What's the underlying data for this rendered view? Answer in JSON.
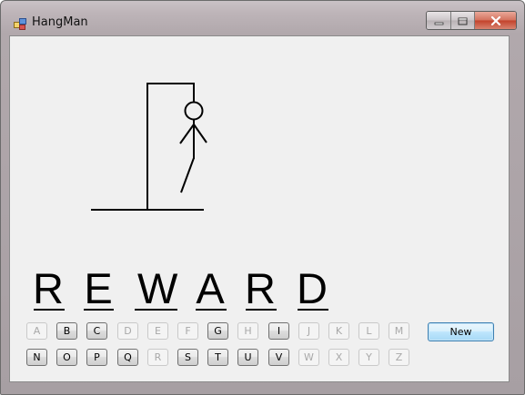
{
  "window": {
    "title": "HangMan",
    "icon": "app-window-icon",
    "controls": {
      "minimize": "minimize-icon",
      "maximize": "maximize-icon",
      "close": "close-icon"
    }
  },
  "hangman": {
    "drawing": "gallows-with-figure",
    "parts_shown": [
      "base",
      "post",
      "beam",
      "rope",
      "head",
      "body",
      "left-arm",
      "right-arm",
      "left-leg"
    ]
  },
  "word": {
    "letters": [
      "R",
      "E",
      "W",
      "A",
      "R",
      "D"
    ]
  },
  "keyboard": {
    "row1": [
      {
        "label": "A",
        "enabled": false
      },
      {
        "label": "B",
        "enabled": true
      },
      {
        "label": "C",
        "enabled": true
      },
      {
        "label": "D",
        "enabled": false
      },
      {
        "label": "E",
        "enabled": false
      },
      {
        "label": "F",
        "enabled": false
      },
      {
        "label": "G",
        "enabled": true
      },
      {
        "label": "H",
        "enabled": false
      },
      {
        "label": "I",
        "enabled": true
      },
      {
        "label": "J",
        "enabled": false
      },
      {
        "label": "K",
        "enabled": false
      },
      {
        "label": "L",
        "enabled": false
      },
      {
        "label": "M",
        "enabled": false
      }
    ],
    "row2": [
      {
        "label": "N",
        "enabled": true
      },
      {
        "label": "O",
        "enabled": true
      },
      {
        "label": "P",
        "enabled": true
      },
      {
        "label": "Q",
        "enabled": true
      },
      {
        "label": "R",
        "enabled": false
      },
      {
        "label": "S",
        "enabled": true
      },
      {
        "label": "T",
        "enabled": true
      },
      {
        "label": "U",
        "enabled": true
      },
      {
        "label": "V",
        "enabled": true
      },
      {
        "label": "W",
        "enabled": false
      },
      {
        "label": "X",
        "enabled": false
      },
      {
        "label": "Y",
        "enabled": false
      },
      {
        "label": "Z",
        "enabled": false
      }
    ]
  },
  "actions": {
    "new_label": "New"
  },
  "colors": {
    "close_button": "#c3422a",
    "default_button_border": "#3c7fb1",
    "client_background": "#f0f0f0"
  }
}
